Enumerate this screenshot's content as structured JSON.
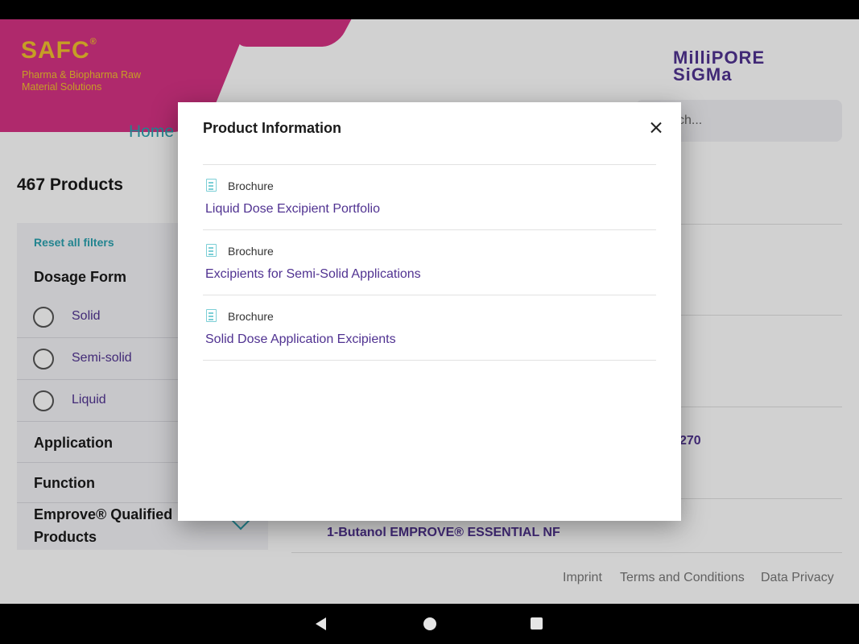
{
  "brand": {
    "safc": "SAFC",
    "safc_reg": "®",
    "tagline": "Pharma & Biopharma Raw Material Solutions",
    "partner_line1": "MilliPORE",
    "partner_line2": "SiGMa",
    "accent_color": "#d63384",
    "logo_color": "#f2c12e"
  },
  "search": {
    "placeholder": "ch..."
  },
  "nav": {
    "home": "Home"
  },
  "results": {
    "count_label": "467 Products",
    "items": [
      {
        "label": "270"
      },
      {
        "label": "1-Butanol EMPROVE® ESSENTIAL NF"
      }
    ]
  },
  "filters": {
    "reset_label": "Reset all filters",
    "dosage_form": {
      "title": "Dosage Form",
      "options": [
        "Solid",
        "Semi-solid",
        "Liquid"
      ]
    },
    "sections": [
      "Application",
      "Function",
      "Emprove® Qualified Products"
    ]
  },
  "footer": {
    "imprint": "Imprint",
    "terms": "Terms and Conditions",
    "privacy": "Data Privacy"
  },
  "modal": {
    "title": "Product Information",
    "documents": [
      {
        "type": "Brochure",
        "title": "Liquid Dose Excipient Portfolio"
      },
      {
        "type": "Brochure",
        "title": "Excipients for Semi-Solid Applications"
      },
      {
        "type": "Brochure",
        "title": "Solid Dose Application Excipients"
      }
    ]
  },
  "colors": {
    "link": "#503291",
    "teal": "#2aa1af"
  }
}
